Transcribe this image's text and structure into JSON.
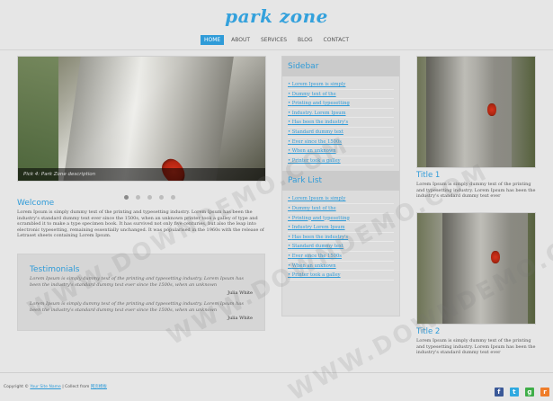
{
  "logo": "park zone",
  "nav": [
    "HOME",
    "ABOUT",
    "SERVICES",
    "BLOG",
    "CONTACT"
  ],
  "slider": {
    "caption": "Pick 4: Park Zone description"
  },
  "welcome": {
    "title": "Welcome",
    "text": "Lorem Ipsum is simply dummy text of the printing and typesetting industry. Lorem Ipsum has been the industry's standard dummy text ever since the 1500s, when an unknown printer took a galley of type and scrambled it to make a type specimen book. It has survived not only five centuries, but also the leap into electronic typesetting, remaining essentially unchanged. It was popularised in the 1960s with the release of Letraset sheets containing Lorem Ipsum."
  },
  "testimonials": {
    "title": "Testimonials",
    "items": [
      {
        "quote": "Lorem Ipsum is simply dummy text of the printing and typesetting industry. Lorem Ipsum has been the industry's standard dummy text ever since the 1500s, when an unknown",
        "author": "Julia White"
      },
      {
        "quote": "Lorem Ipsum is simply dummy text of the printing and typesetting industry. Lorem Ipsum has been the industry's standard dummy text ever since the 1500s, when an unknown",
        "author": "Julia White"
      }
    ]
  },
  "sidebar": {
    "title": "Sidebar",
    "items": [
      "Lorem Ipsum is simply",
      "Dummy text of the",
      "Printing and typesetting",
      "Industry. Lorem Ipsum",
      "Has been the industry's",
      "Standard dummy text",
      "Ever since the 1500s",
      "When an unknown",
      "Printer took a galley"
    ]
  },
  "park_list": {
    "title": "Park List",
    "items": [
      "Lorem Ipsum is simply",
      "Dummy text of the",
      "Printing and typesetting",
      "Industry Lorem Ipsum",
      "Has been the industry's",
      "Standard dummy text",
      "Ever since the 1500s",
      "When an unknown",
      "Printer took a galley"
    ]
  },
  "cards": [
    {
      "title": "Title 1",
      "text": "Lorem Ipsum is simply dummy text of the printing and typesetting industry. Lorem Ipsum has been the industry's standard dummy text ever"
    },
    {
      "title": "Title 2",
      "text": "Lorem Ipsum is simply dummy text of the printing and typesetting industry. Lorem Ipsum has been the industry's standard dummy text ever"
    }
  ],
  "footer": {
    "prefix": "Copyright ©",
    "link1": "Your Site Name",
    "sep": "| Collect from",
    "link2": "网页模板"
  },
  "social": [
    "f",
    "t",
    "g",
    "r"
  ],
  "social_colors": [
    "#3b5998",
    "#2fa9e0",
    "#3fae49",
    "#ef7d2a"
  ],
  "watermark": "WWW.DOWNDEMO.COM"
}
